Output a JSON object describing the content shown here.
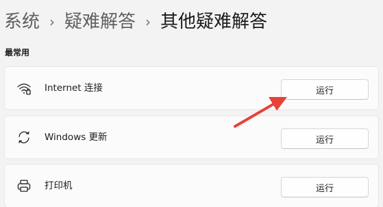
{
  "breadcrumb": {
    "level1": "系统",
    "level2": "疑难解答",
    "current": "其他疑难解答",
    "separator": "›"
  },
  "section": {
    "title": "最常用"
  },
  "troubleshooters": [
    {
      "icon": "wifi-icon",
      "label": "Internet 连接",
      "button": "运行"
    },
    {
      "icon": "windows-update-icon",
      "label": "Windows 更新",
      "button": "运行"
    },
    {
      "icon": "printer-icon",
      "label": "打印机",
      "button": "运行"
    }
  ],
  "annotation": {
    "arrow_color": "#e8403a",
    "points_to": "troubleshooters.0.button"
  }
}
